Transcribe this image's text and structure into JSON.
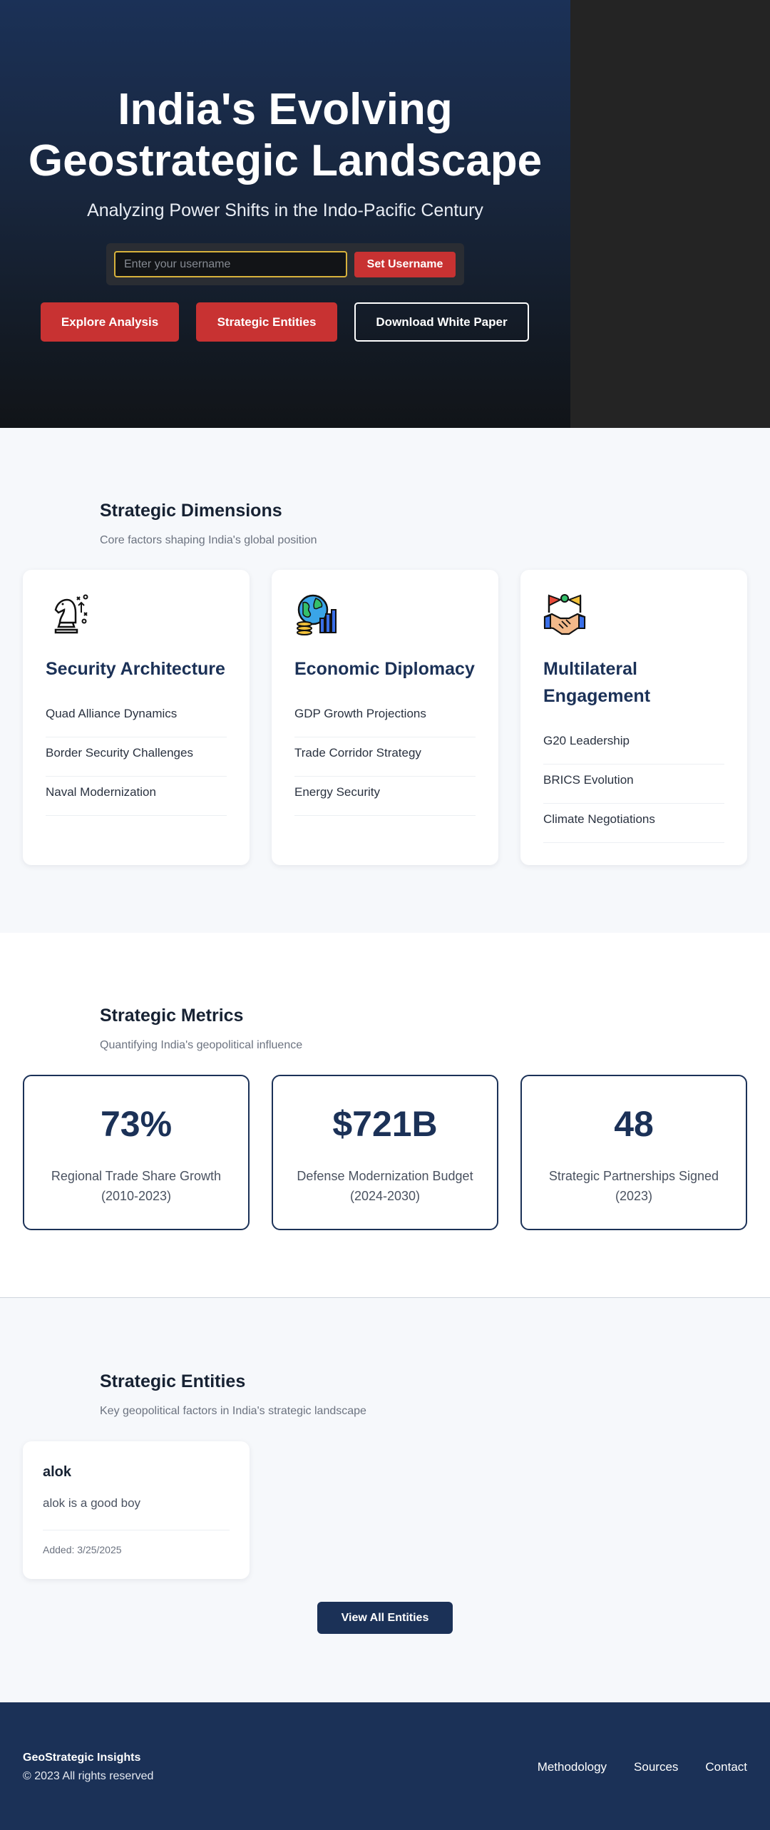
{
  "hero": {
    "title": "India's Evolving Geostrategic Landscape",
    "subtitle": "Analyzing Power Shifts in the Indo-Pacific Century",
    "username_placeholder": "Enter your username",
    "set_username_label": "Set Username",
    "buttons": [
      "Explore Analysis",
      "Strategic Entities",
      "Download White Paper"
    ]
  },
  "dimensions": {
    "title": "Strategic Dimensions",
    "description": "Core factors shaping India's global position",
    "cards": [
      {
        "icon": "chess-knight-icon",
        "title": "Security Architecture",
        "items": [
          "Quad Alliance Dynamics",
          "Border Security Challenges",
          "Naval Modernization"
        ]
      },
      {
        "icon": "globe-growth-icon",
        "title": "Economic Diplomacy",
        "items": [
          "GDP Growth Projections",
          "Trade Corridor Strategy",
          "Energy Security"
        ]
      },
      {
        "icon": "handshake-flags-icon",
        "title": "Multilateral Engagement",
        "items": [
          "G20 Leadership",
          "BRICS Evolution",
          "Climate Negotiations"
        ]
      }
    ]
  },
  "metrics": {
    "title": "Strategic Metrics",
    "description": "Quantifying India's geopolitical influence",
    "items": [
      {
        "value": "73%",
        "label": "Regional Trade Share Growth (2010-2023)"
      },
      {
        "value": "$721B",
        "label": "Defense Modernization Budget (2024-2030)"
      },
      {
        "value": "48",
        "label": "Strategic Partnerships Signed (2023)"
      }
    ]
  },
  "entities": {
    "title": "Strategic Entities",
    "description": "Key geopolitical factors in India's strategic landscape",
    "items": [
      {
        "name": "alok",
        "description": "alok is a good boy",
        "added": "Added: 3/25/2025"
      }
    ],
    "view_all_label": "View All Entities"
  },
  "footer": {
    "brand": "GeoStrategic Insights",
    "copyright": "© 2023 All rights reserved",
    "links": [
      "Methodology",
      "Sources",
      "Contact"
    ]
  },
  "colors": {
    "navy": "#1b3157",
    "accent_red": "#c83232",
    "input_border": "#d8b23c"
  }
}
